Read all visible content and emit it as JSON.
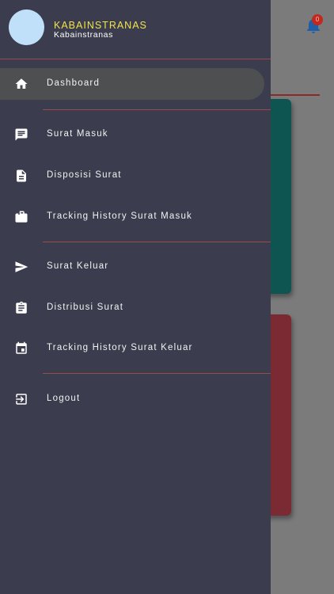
{
  "background": {
    "notification_badge": "0"
  },
  "drawer": {
    "user": {
      "name": "KABAINSTRANAS",
      "subtitle": "Kabainstranas"
    },
    "items": [
      {
        "label": "Dashboard",
        "icon": "home-icon",
        "active": true
      },
      {
        "label": "Surat Masuk",
        "icon": "message-icon"
      },
      {
        "label": "Disposisi Surat",
        "icon": "document-icon"
      },
      {
        "label": "Tracking History Surat Masuk",
        "icon": "work-icon"
      },
      {
        "label": "Surat Keluar",
        "icon": "send-icon"
      },
      {
        "label": "Distribusi Surat",
        "icon": "clipboard-icon"
      },
      {
        "label": "Tracking History Surat Keluar",
        "icon": "calendar-icon"
      },
      {
        "label": "Logout",
        "icon": "logout-icon"
      }
    ]
  },
  "colors": {
    "drawer_bg": "#3b3c4d",
    "active_item_bg": "#4d4f51",
    "divider": "#9a4a4a",
    "name_accent": "#f2e34b",
    "card_teal": "#0e5552",
    "card_red": "#7b2a33",
    "badge_red": "#c2281e"
  }
}
